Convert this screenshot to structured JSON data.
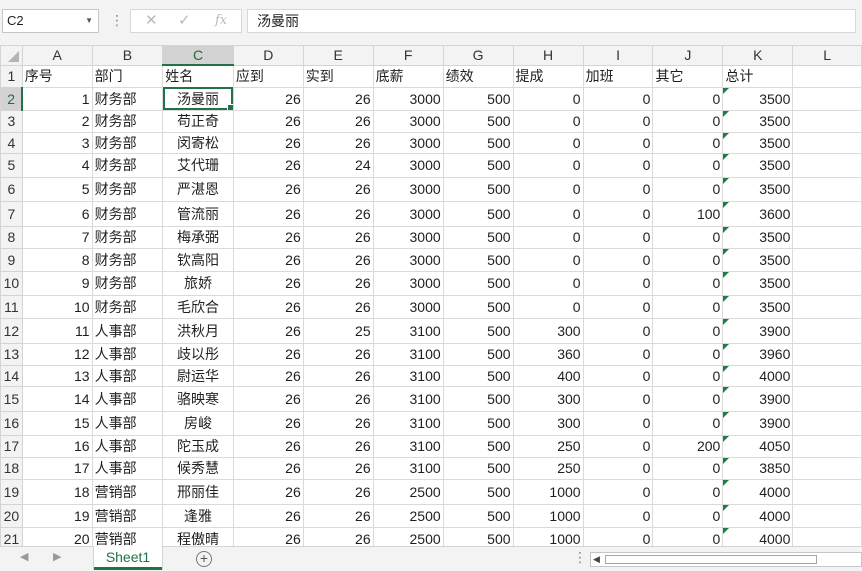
{
  "formula_bar": {
    "name_box": "C2",
    "content": "汤曼丽",
    "cancel_icon": "✕",
    "enter_icon": "✓",
    "fx_icon": "fx"
  },
  "columns": [
    "A",
    "B",
    "C",
    "D",
    "E",
    "F",
    "G",
    "H",
    "I",
    "J",
    "K",
    "L"
  ],
  "selected_column": "C",
  "selected_row": 2,
  "headers": [
    "序号",
    "部门",
    "姓名",
    "应到",
    "实到",
    "底薪",
    "绩效",
    "提成",
    "加班",
    "其它",
    "总计"
  ],
  "rows": [
    {
      "n": "2",
      "v": [
        "1",
        "财务部",
        "汤曼丽",
        "26",
        "26",
        "3000",
        "500",
        "0",
        "0",
        "0",
        "3500"
      ]
    },
    {
      "n": "3",
      "v": [
        "2",
        "财务部",
        "苟正奇",
        "26",
        "26",
        "3000",
        "500",
        "0",
        "0",
        "0",
        "3500"
      ]
    },
    {
      "n": "4",
      "v": [
        "3",
        "财务部",
        "闵寄松",
        "26",
        "26",
        "3000",
        "500",
        "0",
        "0",
        "0",
        "3500"
      ]
    },
    {
      "n": "5",
      "v": [
        "4",
        "财务部",
        "艾代珊",
        "26",
        "24",
        "3000",
        "500",
        "0",
        "0",
        "0",
        "3500"
      ]
    },
    {
      "n": "6",
      "v": [
        "5",
        "财务部",
        "严湛恩",
        "26",
        "26",
        "3000",
        "500",
        "0",
        "0",
        "0",
        "3500"
      ]
    },
    {
      "n": "7",
      "v": [
        "6",
        "财务部",
        "管流丽",
        "26",
        "26",
        "3000",
        "500",
        "0",
        "0",
        "100",
        "3600"
      ]
    },
    {
      "n": "8",
      "v": [
        "7",
        "财务部",
        "梅承弼",
        "26",
        "26",
        "3000",
        "500",
        "0",
        "0",
        "0",
        "3500"
      ]
    },
    {
      "n": "9",
      "v": [
        "8",
        "财务部",
        "钦高阳",
        "26",
        "26",
        "3000",
        "500",
        "0",
        "0",
        "0",
        "3500"
      ]
    },
    {
      "n": "10",
      "v": [
        "9",
        "财务部",
        "旅娇",
        "26",
        "26",
        "3000",
        "500",
        "0",
        "0",
        "0",
        "3500"
      ]
    },
    {
      "n": "11",
      "v": [
        "10",
        "财务部",
        "毛欣合",
        "26",
        "26",
        "3000",
        "500",
        "0",
        "0",
        "0",
        "3500"
      ]
    },
    {
      "n": "12",
      "v": [
        "11",
        "人事部",
        "洪秋月",
        "26",
        "25",
        "3100",
        "500",
        "300",
        "0",
        "0",
        "3900"
      ]
    },
    {
      "n": "13",
      "v": [
        "12",
        "人事部",
        "歧以彤",
        "26",
        "26",
        "3100",
        "500",
        "360",
        "0",
        "0",
        "3960"
      ]
    },
    {
      "n": "14",
      "v": [
        "13",
        "人事部",
        "尉运华",
        "26",
        "26",
        "3100",
        "500",
        "400",
        "0",
        "0",
        "4000"
      ]
    },
    {
      "n": "15",
      "v": [
        "14",
        "人事部",
        "骆映寒",
        "26",
        "26",
        "3100",
        "500",
        "300",
        "0",
        "0",
        "3900"
      ]
    },
    {
      "n": "16",
      "v": [
        "15",
        "人事部",
        "房峻",
        "26",
        "26",
        "3100",
        "500",
        "300",
        "0",
        "0",
        "3900"
      ]
    },
    {
      "n": "17",
      "v": [
        "16",
        "人事部",
        "陀玉成",
        "26",
        "26",
        "3100",
        "500",
        "250",
        "0",
        "200",
        "4050"
      ]
    },
    {
      "n": "18",
      "v": [
        "17",
        "人事部",
        "候秀慧",
        "26",
        "26",
        "3100",
        "500",
        "250",
        "0",
        "0",
        "3850"
      ]
    },
    {
      "n": "19",
      "v": [
        "18",
        "营销部",
        "邢丽佳",
        "26",
        "26",
        "2500",
        "500",
        "1000",
        "0",
        "0",
        "4000"
      ]
    },
    {
      "n": "20",
      "v": [
        "19",
        "营销部",
        "逢雅",
        "26",
        "26",
        "2500",
        "500",
        "1000",
        "0",
        "0",
        "4000"
      ]
    },
    {
      "n": "21",
      "v": [
        "20",
        "营销部",
        "程傲晴",
        "26",
        "26",
        "2500",
        "500",
        "1000",
        "0",
        "0",
        "4000"
      ]
    }
  ],
  "sheet_tabs": [
    "Sheet1"
  ],
  "add_sheet_icon": "+",
  "colors": {
    "accent": "#217346",
    "header_bg": "#f3f3f3",
    "gridline": "#dadada"
  }
}
